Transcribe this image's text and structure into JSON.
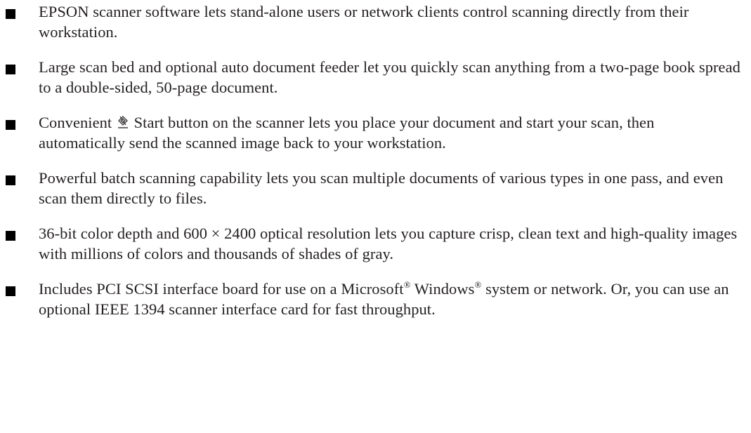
{
  "features": {
    "item1": {
      "text": "EPSON scanner software lets stand-alone users or network clients control scanning directly from their workstation."
    },
    "item2": {
      "text": "Large scan bed and optional auto document feeder let you quickly scan anything from a two-page book spread to a double-sided, 50-page document."
    },
    "item3": {
      "before_icon": "Convenient",
      "icon": "start-button-icon",
      "after_icon": "Start button on the scanner lets you place your document and start your scan, then automatically send the scanned image back to your workstation."
    },
    "item4": {
      "text": "Powerful batch scanning capability lets you scan multiple documents of various types in one pass, and even scan them directly to files."
    },
    "item5": {
      "text": "36-bit color depth and 600 × 2400 optical resolution lets you capture crisp, clean text and high-quality images with millions of colors and thousands of shades of gray."
    },
    "item6": {
      "part1": "Includes PCI SCSI interface board for use on a Microsoft",
      "reg1": "®",
      "part2": " Windows",
      "reg2": "®",
      "part3": " system or network. Or, you can use an optional IEEE 1394 scanner interface card for fast throughput."
    }
  },
  "colors": {
    "text": "#231f20",
    "bullet": "#000000",
    "background": "#ffffff"
  },
  "bullet_icon": "square-bullet"
}
